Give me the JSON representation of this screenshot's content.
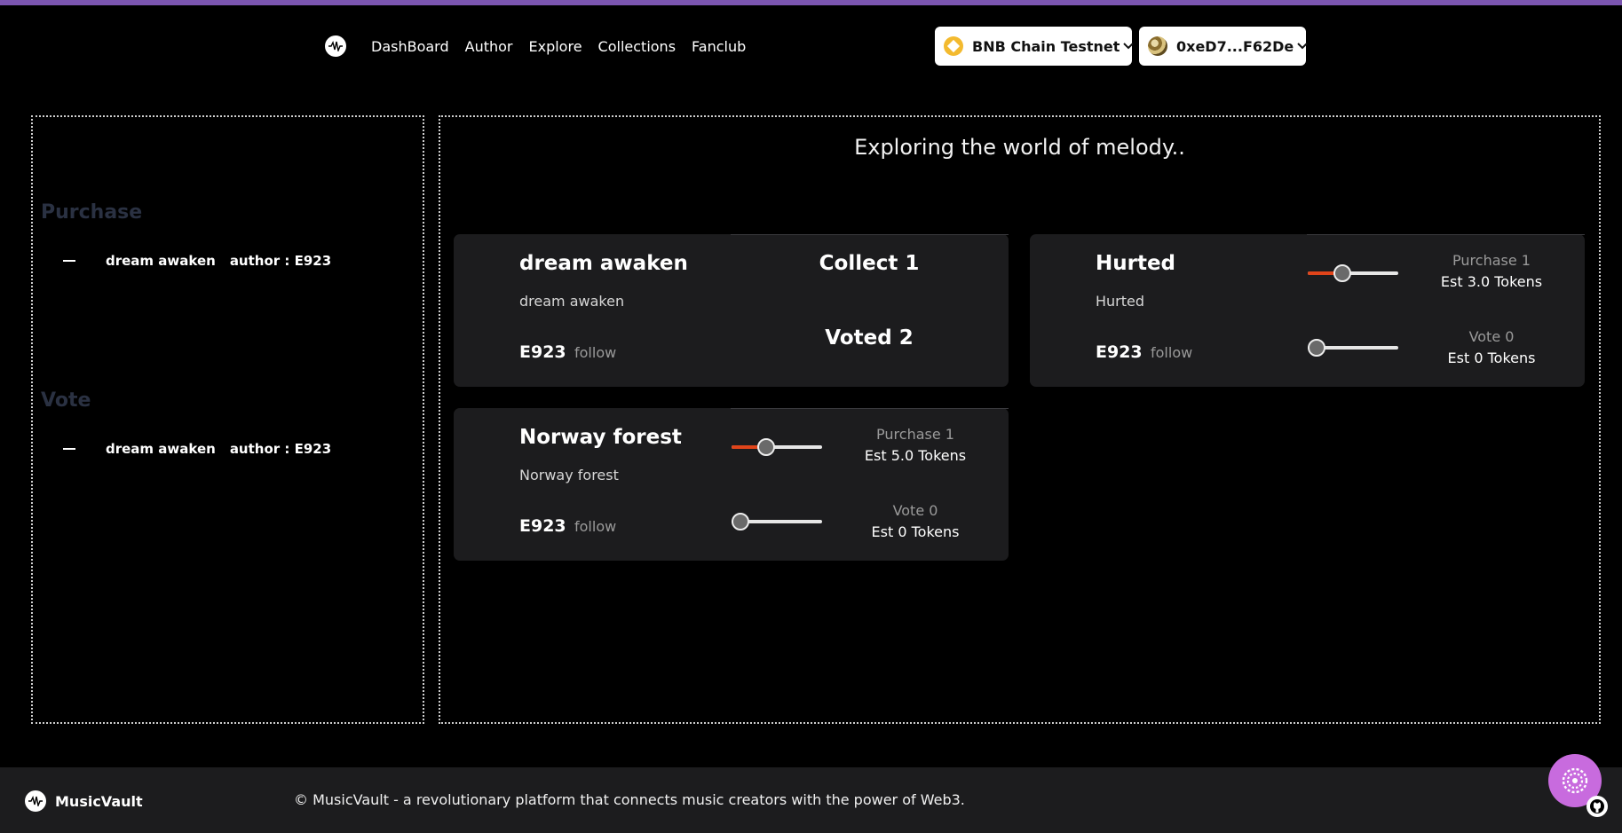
{
  "header": {
    "nav": [
      "DashBoard",
      "Author",
      "Explore",
      "Collections",
      "Fanclub"
    ],
    "chain_label": "BNB Chain Testnet",
    "wallet_label": "0xeD7...F62De"
  },
  "sidebar": {
    "purchase_title": "Purchase",
    "purchase_items": [
      {
        "song": "dream awaken",
        "author": "author : E923"
      }
    ],
    "vote_title": "Vote",
    "vote_items": [
      {
        "song": "dream awaken",
        "author": "author : E923"
      }
    ]
  },
  "main": {
    "headline": "Exploring the world of melody..",
    "cards": [
      {
        "title": "dream awaken",
        "subtitle": "dream awaken",
        "author": "E923",
        "follow_label": "follow",
        "collect_label": "Collect 1",
        "voted_label": "Voted 2"
      },
      {
        "title": "Hurted",
        "subtitle": "Hurted",
        "author": "E923",
        "follow_label": "follow",
        "purchase_label": "Purchase 1",
        "purchase_est": "Est 3.0 Tokens",
        "vote_label": "Vote 0",
        "vote_est": "Est 0 Tokens",
        "purchase_slider_fraction": 0.35,
        "vote_slider_fraction": 0.0
      },
      {
        "title": "Norway forest",
        "subtitle": "Norway forest",
        "author": "E923",
        "follow_label": "follow",
        "purchase_label": "Purchase 1",
        "purchase_est": "Est 5.0 Tokens",
        "vote_label": "Vote 0",
        "vote_est": "Est 0 Tokens",
        "purchase_slider_fraction": 0.35,
        "vote_slider_fraction": 0.0
      }
    ]
  },
  "footer": {
    "brand": "MusicVault",
    "copyright": "© MusicVault - a revolutionary platform that connects music creators with the power of Web3."
  },
  "colors": {
    "accent_bar": "#7b55b0",
    "slider_fill": "#e0441a",
    "fab": "#c86bde"
  },
  "icons": [
    "waveform-logo-icon",
    "bnb-coin-icon",
    "wallet-avatar-icon",
    "chevron-down-icon",
    "support-chat-icon",
    "github-icon"
  ]
}
